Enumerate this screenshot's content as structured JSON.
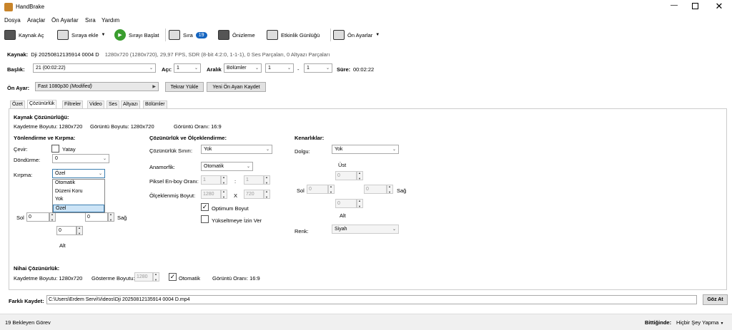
{
  "app": {
    "title": "HandBrake"
  },
  "menu": [
    "Dosya",
    "Araçlar",
    "Ön Ayarlar",
    "Sıra",
    "Yardım"
  ],
  "toolbar": {
    "open_source": "Kaynak Aç",
    "add_queue": "Sıraya ekle",
    "start_queue": "Sırayı Başlat",
    "queue": "Sıra",
    "queue_count": "19",
    "preview": "Önizleme",
    "activity_log": "Etkinlik Günlüğü",
    "presets": "Ön Ayarlar"
  },
  "source": {
    "label": "Kaynak:",
    "name": "Dji 20250812135914 0004 D",
    "info": "1280x720 (1280x720), 29,97 FPS, SDR (8-bit 4:2:0, 1-1-1), 0 Ses Parçaları, 0 Altyazı Parçaları"
  },
  "title_row": {
    "title_label": "Başlık:",
    "title_value": "21 (00:02:22)",
    "angle_label": "Açı:",
    "angle_value": "1",
    "range_label": "Aralık",
    "range_mode": "Bölümler",
    "range_start": "1",
    "range_sep": "-",
    "range_end": "1",
    "duration_label": "Süre:",
    "duration_value": "00:02:22"
  },
  "preset_row": {
    "label": "Ön Ayar:",
    "value": "Fast 1080p30",
    "modified": "(Modified)",
    "reload": "Tekrar Yükle",
    "save_new": "Yeni Ön Ayarı Kaydet"
  },
  "tabs": [
    "Özet",
    "Çözünürlük",
    "Filtreler",
    "Video",
    "Ses",
    "Altyazı",
    "Bölümler"
  ],
  "source_res": {
    "title": "Kaynak Çözünürlüğü:",
    "storage": "Kaydetme Boyutu: 1280x720",
    "display": "Görüntü Boyutu: 1280x720",
    "aspect": "Görüntü Oranı: 16:9"
  },
  "orientation": {
    "title": "Yönlendirme ve Kırpma:",
    "flip_label": "Çevir:",
    "flip_horizontal": "Yatay",
    "rotate_label": "Döndürme:",
    "rotate_value": "0",
    "crop_label": "Kırpma:",
    "crop_value": "Özel",
    "crop_options": [
      "Otomatik",
      "Düzeni Koru",
      "Yok",
      "Özel"
    ],
    "left_label": "Sol",
    "left_value": "0",
    "right_value": "0",
    "right_label": "Sağ",
    "bottom_value": "0",
    "bottom_label": "Alt"
  },
  "resolution": {
    "title": "Çözünürlük ve Ölçeklendirme:",
    "limit_label": "Çözünürlük Sınırı:",
    "limit_value": "Yok",
    "anamorphic_label": "Anamorfik:",
    "anamorphic_value": "Otomatik",
    "par_label": "Piksel En-boy Oranı:",
    "par_w": "1",
    "par_sep": ":",
    "par_h": "1",
    "scaled_label": "Ölçeklenmiş Boyut:",
    "scaled_w": "1280",
    "scaled_x": "X",
    "scaled_h": "720",
    "optimal_label": "Optimum Boyut",
    "optimal_checked": true,
    "upscale_label": "Yükseltmeye İzin Ver",
    "upscale_checked": false
  },
  "borders": {
    "title": "Kenarlıklar:",
    "fill_label": "Dolgu:",
    "fill_value": "Yok",
    "top_label": "Üst",
    "top_value": "0",
    "left_label": "Sol",
    "left_value": "0",
    "right_value": "0",
    "right_label": "Sağ",
    "bottom_value": "0",
    "bottom_label": "Alt",
    "color_label": "Renk:",
    "color_value": "Siyah"
  },
  "final_res": {
    "title": "Nihai Çözünürlük:",
    "storage": "Kaydetme Boyutu: 1280x720",
    "display_label": "Gösterme Boyutu:",
    "display_value": "1280",
    "auto_label": "Otomatik",
    "auto_checked": true,
    "aspect": "Görüntü Oranı: 16:9"
  },
  "save_as": {
    "label": "Farklı Kaydet:",
    "path": "C:\\Users\\Erdem Servi\\Videos\\Dji 20250812135914 0004 D.mp4",
    "browse": "Göz At"
  },
  "status": {
    "pending": "19 Bekleyen Görev",
    "when_done_label": "Bittiğinde:",
    "when_done_value": "Hiçbir Şey Yapma"
  },
  "colors": {
    "accent": "#0a64c8",
    "badge": "#1565c0",
    "selected": "#cce4f7"
  }
}
